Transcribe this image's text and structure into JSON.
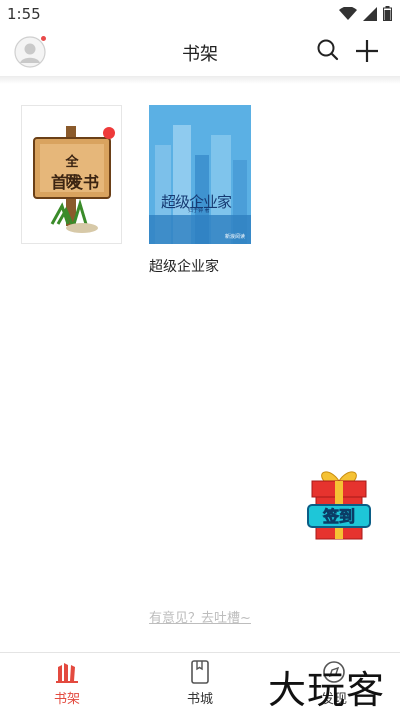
{
  "status_bar": {
    "time": "1:55",
    "icons": [
      "wifi-icon",
      "signal-icon",
      "battery-icon"
    ]
  },
  "header": {
    "title": "书架",
    "icons": [
      "avatar",
      "search-icon",
      "plus-icon"
    ]
  },
  "books": [
    {
      "cover_line1": "全网",
      "cover_line2": "首发书",
      "title": "",
      "new_badge": true
    },
    {
      "cover_title": "超级企业家",
      "cover_author": "归于钟 著",
      "cover_logo": "新浪阅读",
      "title": "超级企业家"
    }
  ],
  "floating": {
    "gift_label": "签到"
  },
  "feedback_link": "有意见？去吐槽~",
  "bottom_nav": [
    {
      "label": "书架",
      "icon": "bookshelf-icon",
      "active": true
    },
    {
      "label": "书城",
      "icon": "book-icon",
      "active": false
    },
    {
      "label": "发现",
      "icon": "discover-icon",
      "active": false
    }
  ],
  "watermark": "大玩客",
  "colors": {
    "accent": "#e34a3f",
    "badge": "#ee3a3a",
    "muted": "#bdbdbd"
  }
}
